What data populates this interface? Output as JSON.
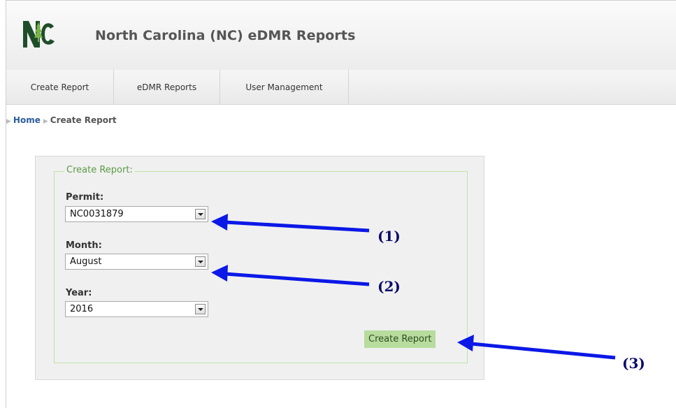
{
  "app": {
    "title": "North Carolina (NC) eDMR Reports",
    "logo_text": "NC"
  },
  "nav": {
    "items": [
      {
        "label": "Create Report"
      },
      {
        "label": "eDMR Reports"
      },
      {
        "label": "User Management"
      }
    ]
  },
  "breadcrumb": {
    "home": "Home",
    "current": "Create Report"
  },
  "form": {
    "legend": "Create Report:",
    "permit_label": "Permit:",
    "permit_value": "NC0031879",
    "month_label": "Month:",
    "month_value": "August",
    "year_label": "Year:",
    "year_value": "2016",
    "submit_label": "Create Report"
  },
  "annotations": {
    "a1": "(1)",
    "a2": "(2)",
    "a3": "(3)"
  },
  "colors": {
    "accent_green": "#b7dc9d",
    "legend_green": "#5a9b43",
    "arrow_blue": "#0b18e6",
    "link_blue": "#2a5c9a"
  }
}
